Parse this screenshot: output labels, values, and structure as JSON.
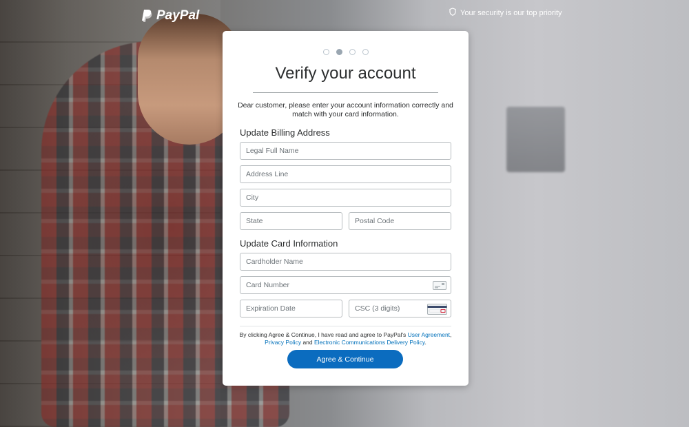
{
  "header": {
    "brand": "PayPal",
    "security_text": "Your security is our top priority"
  },
  "progress": {
    "total_steps": 4,
    "current_step": 2
  },
  "form": {
    "title": "Verify your account",
    "intro": "Dear customer, please enter your account information correctly and match with your card information.",
    "billing_heading": "Update Billing Address",
    "billing_fields": {
      "legal_name": "Legal Full Name",
      "address_line": "Address Line",
      "city": "City",
      "state": "State",
      "postal_code": "Postal Code"
    },
    "card_heading": "Update Card Information",
    "card_fields": {
      "cardholder_name": "Cardholder Name",
      "card_number": "Card Number",
      "expiration_date": "Expiration Date",
      "csc": "CSC (3 digits)"
    },
    "legal": {
      "prefix": "By clicking Agree & Continue, I have read and agree to PayPal's ",
      "user_agreement": "User Agreement",
      "comma": ",",
      "privacy_policy": "Privacy Policy",
      "and": " and ",
      "ecd_policy": "Electronic Communications Delivery Policy",
      "suffix": "."
    },
    "submit_label": "Agree & Continue"
  },
  "colors": {
    "accent": "#0b6cbf",
    "link": "#0070ba",
    "text": "#2c2e2f"
  },
  "icons": {
    "logo": "paypal-logo-icon",
    "security": "shield-icon",
    "card_number": "credit-card-icon",
    "csc": "card-back-csc-icon"
  }
}
